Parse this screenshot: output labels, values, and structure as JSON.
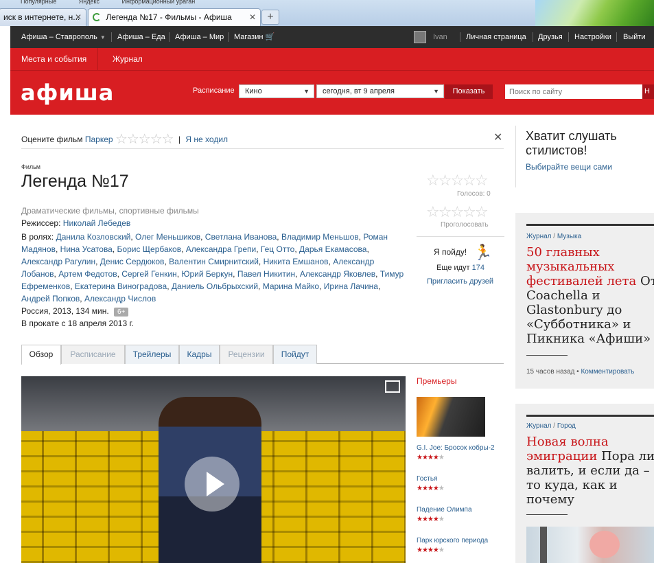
{
  "browser": {
    "bookmarks": [
      "Популярные",
      "Яндекс",
      "Информационный ураган"
    ],
    "tabs": [
      {
        "label": "иск в интернете, н...",
        "close": "✕"
      },
      {
        "label": "Легенда №17 - Фильмы - Афиша",
        "close": "✕"
      }
    ],
    "new_tab": "+"
  },
  "topbar": {
    "left": [
      "Афиша – Ставрополь",
      "Афиша – Еда",
      "Афиша – Мир",
      "Магазин"
    ],
    "user": "Ivan",
    "right": [
      "Личная страница",
      "Друзья",
      "Настройки",
      "Выйти"
    ]
  },
  "header": {
    "tabs": [
      "Места и события",
      "Журнал"
    ],
    "logo": "афиша",
    "schedule_label": "Расписание",
    "category": "Кино",
    "date": "сегодня, вт 9 апреля",
    "show_button": "Показать",
    "search_placeholder": "Поиск по сайту",
    "search_button": "Н"
  },
  "rate": {
    "label": "Оцените фильм",
    "user": "Паркер",
    "stars": "☆☆☆☆☆",
    "pipe": "|",
    "not_went": "Я не ходил",
    "close": "✕"
  },
  "film": {
    "label": "Фильм",
    "title": "Легенда №17",
    "genres": "Драматические фильмы, спортивные фильмы",
    "director_label": "Режиссер:",
    "director": "Николай Лебедев",
    "cast_label": "В ролях:",
    "cast": [
      "Данила Козловский",
      "Олег Меньшиков",
      "Светлана Иванова",
      "Владимир Меньшов",
      "Роман Мадянов",
      "Нина Усатова",
      "Борис Щербаков",
      "Александра Грепи",
      "Гец Отто",
      "Дарья Екамасова",
      "Александр Рагулин",
      "Денис Сердюков",
      "Валентин Смирнитский",
      "Никита Емшанов",
      "Александр Лобанов",
      "Артем Федотов",
      "Сергей Генкин",
      "Юрий Беркун",
      "Павел Никитин",
      "Александр Яковлев",
      "Тимур Ефременков",
      "Екатерина Виноградова",
      "Даниель Ольбрыхский",
      "Марина Майко",
      "Ирина Лачина",
      "Андрей Попков",
      "Александр Числов"
    ],
    "country": "Россия, 2013, 134 мин.",
    "age": "6+",
    "release": "В прокате с 18 апреля 2013 г."
  },
  "ratings": {
    "stars": "☆☆☆☆☆",
    "votes": "Голосов: 0",
    "voted": "Проголосовать",
    "going": "Я пойду!",
    "going_icon": "running-man-icon",
    "going_more_label": "Еще идут",
    "going_more_count": "174",
    "invite": "Пригласить друзей"
  },
  "content_tabs": [
    "Обзор",
    "Расписание",
    "Трейлеры",
    "Кадры",
    "Рецензии",
    "Пойдут"
  ],
  "premieres": {
    "title": "Премьеры",
    "items": [
      {
        "name": "G.I. Joe: Бросок кобры-2",
        "rating": 4
      },
      {
        "name": "Гостья",
        "rating": 4
      },
      {
        "name": "Падение Олимпа",
        "rating": 4
      },
      {
        "name": "Парк юрского периода",
        "rating": 4
      }
    ]
  },
  "sidebar": {
    "ad_title": "Хватит слушать стилистов!",
    "ad_link": "Выбирайте вещи сами",
    "card1": {
      "cat": "Журнал",
      "sep": "/",
      "sub": "Музыка",
      "lines": [
        "50 главных",
        "музыкальных",
        "фестивалей лета",
        "Coachella и",
        "Glastonbury до",
        "«Субботника» и",
        "Пикника «Афиши»"
      ],
      "tail": "От",
      "time": "15 часов назад",
      "dot": "•",
      "comment": "Комментировать"
    },
    "card2": {
      "cat": "Журнал",
      "sep": "/",
      "sub": "Город",
      "lines": [
        "Новая волна",
        "эмиграции",
        "валить, и если да –",
        "то куда, как и",
        "почему"
      ],
      "tail": "Пора ли"
    }
  }
}
